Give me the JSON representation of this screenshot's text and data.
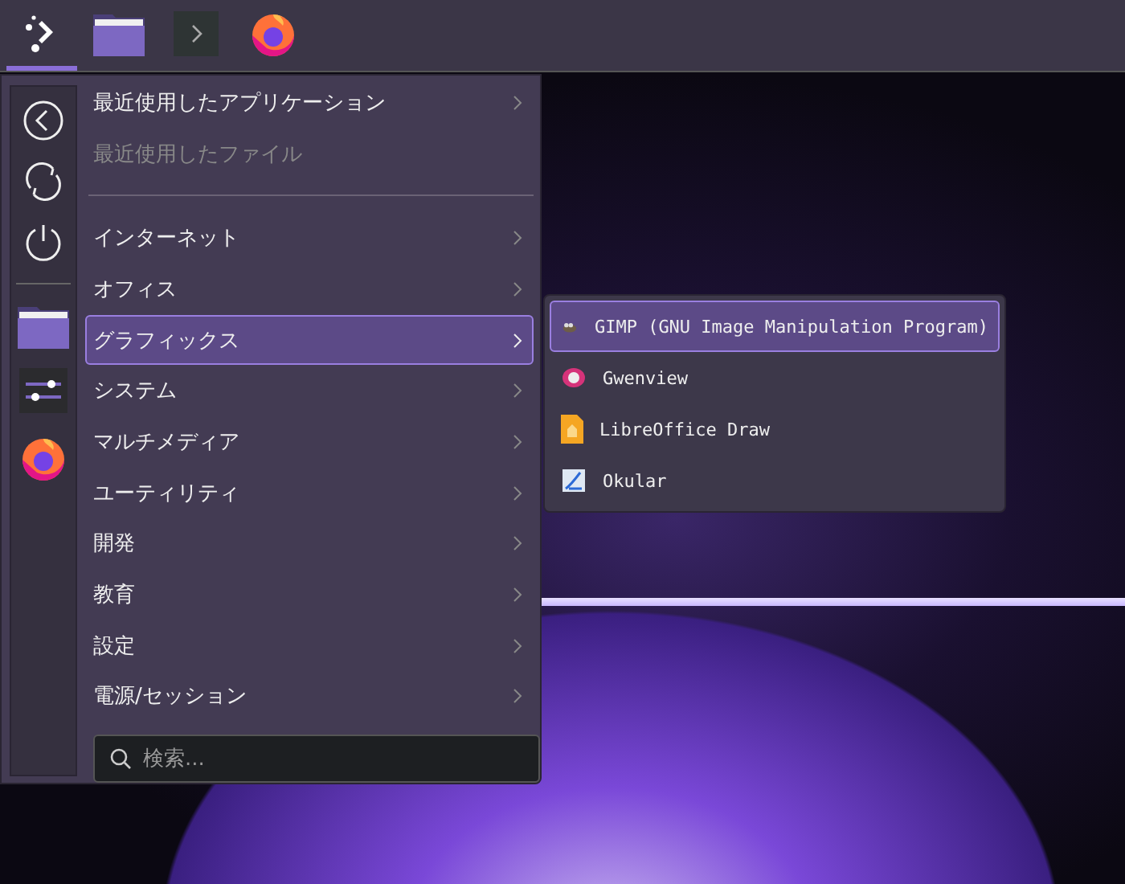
{
  "taskbar": [
    {
      "kind": "launcher",
      "selected": true
    },
    {
      "kind": "folder",
      "selected": false
    },
    {
      "kind": "terminal",
      "selected": false
    },
    {
      "kind": "firefox",
      "selected": false
    }
  ],
  "menu": {
    "items": [
      {
        "kind": "entry",
        "label": "最近使用したアプリケーション",
        "disabled": false,
        "selected": false
      },
      {
        "kind": "entry",
        "label": "最近使用したファイル",
        "disabled": true,
        "selected": false
      },
      {
        "kind": "separator"
      },
      {
        "kind": "entry",
        "label": "インターネット",
        "disabled": false,
        "selected": false
      },
      {
        "kind": "entry",
        "label": "オフィス",
        "disabled": false,
        "selected": false
      },
      {
        "kind": "entry",
        "label": "グラフィックス",
        "disabled": false,
        "selected": true
      },
      {
        "kind": "entry",
        "label": "システム",
        "disabled": false,
        "selected": false
      },
      {
        "kind": "entry",
        "label": "マルチメディア",
        "disabled": false,
        "selected": false
      },
      {
        "kind": "entry",
        "label": "ユーティリティ",
        "disabled": false,
        "selected": false
      },
      {
        "kind": "entry",
        "label": "開発",
        "disabled": false,
        "selected": false
      },
      {
        "kind": "entry",
        "label": "教育",
        "disabled": false,
        "selected": false
      },
      {
        "kind": "entry",
        "label": "設定",
        "disabled": false,
        "selected": false
      },
      {
        "kind": "entry",
        "label": "電源/セッション",
        "disabled": false,
        "selected": false
      }
    ],
    "search": {
      "placeholder": "検索..."
    }
  },
  "submenu": {
    "items": [
      {
        "kind": "gimp",
        "label": "GIMP (GNU Image Manipulation Program)",
        "selected": true
      },
      {
        "kind": "gwenview",
        "label": "Gwenview",
        "selected": false
      },
      {
        "kind": "draw",
        "label": "LibreOffice Draw",
        "selected": false
      },
      {
        "kind": "okular",
        "label": "Okular",
        "selected": false
      }
    ]
  }
}
